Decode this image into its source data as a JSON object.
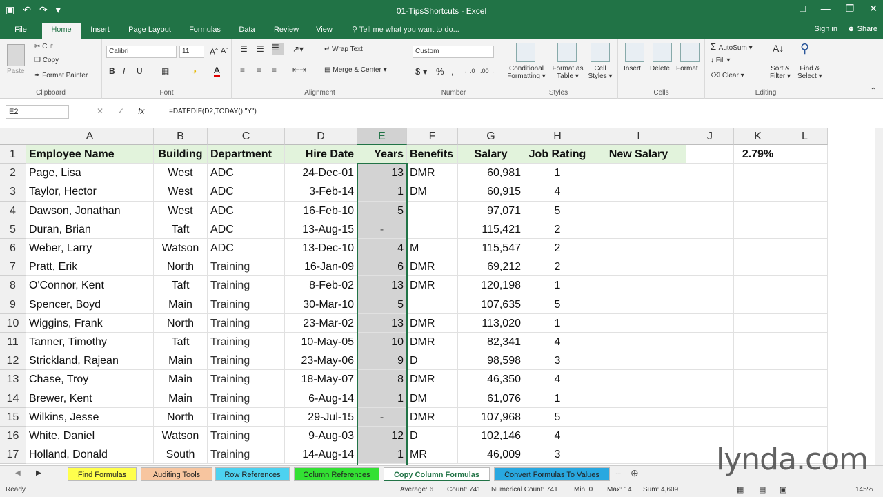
{
  "app": {
    "title": "01-TipsShortcuts - Excel",
    "undo_icon": "undo-icon",
    "redo_icon": "redo-icon",
    "save_icon": "save-icon"
  },
  "tabs": [
    "File",
    "Home",
    "Insert",
    "Page Layout",
    "Formulas",
    "Data",
    "Review",
    "View"
  ],
  "tellme": "Tell me what you want to do...",
  "signin": "Sign in",
  "share": "Share",
  "ribbon": {
    "clipboard": {
      "label": "Clipboard",
      "paste": "Paste",
      "cut": "Cut",
      "copy": "Copy",
      "painter": "Format Painter"
    },
    "font": {
      "label": "Font",
      "name": "Calibri",
      "size": "11"
    },
    "alignment": {
      "label": "Alignment",
      "wrap": "Wrap Text",
      "merge": "Merge & Center"
    },
    "number": {
      "label": "Number",
      "format": "Custom"
    },
    "styles": {
      "label": "Styles",
      "cond": "Conditional",
      "cond2": "Formatting",
      "fmt_table": "Format as",
      "fmt_table2": "Table",
      "cell_styles": "Cell",
      "cell_styles2": "Styles"
    },
    "cells": {
      "label": "Cells",
      "insert": "Insert",
      "delete": "Delete",
      "format": "Format"
    },
    "editing": {
      "label": "Editing",
      "autosum": "AutoSum",
      "fill": "Fill",
      "clear": "Clear",
      "sort": "Sort &",
      "sort2": "Filter",
      "find": "Find &",
      "find2": "Select"
    }
  },
  "formula_bar": {
    "name_box": "E2",
    "formula": "=DATEDIF(D2,TODAY(),\"Y\")",
    "fx": "fx"
  },
  "columns": [
    "A",
    "B",
    "C",
    "D",
    "E",
    "F",
    "G",
    "H",
    "I",
    "J",
    "K",
    "L"
  ],
  "header_row": [
    "Employee Name",
    "Building",
    "Department",
    "Hire Date",
    "Years",
    "Benefits",
    "Salary",
    "Job Rating",
    "New Salary",
    "",
    "2.79%",
    ""
  ],
  "rows": [
    [
      "Page, Lisa",
      "West",
      "ADC",
      "24-Dec-01",
      "13",
      "DMR",
      "60,981",
      "1"
    ],
    [
      "Taylor, Hector",
      "West",
      "ADC",
      "3-Feb-14",
      "1",
      "DM",
      "60,915",
      "4"
    ],
    [
      "Dawson, Jonathan",
      "West",
      "ADC",
      "16-Feb-10",
      "5",
      "",
      "97,071",
      "5"
    ],
    [
      "Duran, Brian",
      "Taft",
      "ADC",
      "13-Aug-15",
      "-",
      "",
      "115,421",
      "2"
    ],
    [
      "Weber, Larry",
      "Watson",
      "ADC",
      "13-Dec-10",
      "4",
      "M",
      "115,547",
      "2"
    ],
    [
      "Pratt, Erik",
      "North",
      "Training",
      "16-Jan-09",
      "6",
      "DMR",
      "69,212",
      "2"
    ],
    [
      "O'Connor, Kent",
      "Taft",
      "Training",
      "8-Feb-02",
      "13",
      "DMR",
      "120,198",
      "1"
    ],
    [
      "Spencer, Boyd",
      "Main",
      "Training",
      "30-Mar-10",
      "5",
      "",
      "107,635",
      "5"
    ],
    [
      "Wiggins, Frank",
      "North",
      "Training",
      "23-Mar-02",
      "13",
      "DMR",
      "113,020",
      "1"
    ],
    [
      "Tanner, Timothy",
      "Taft",
      "Training",
      "10-May-05",
      "10",
      "DMR",
      "82,341",
      "4"
    ],
    [
      "Strickland, Rajean",
      "Main",
      "Training",
      "23-May-06",
      "9",
      "D",
      "98,598",
      "3"
    ],
    [
      "Chase, Troy",
      "Main",
      "Training",
      "18-May-07",
      "8",
      "DMR",
      "46,350",
      "4"
    ],
    [
      "Brewer, Kent",
      "Main",
      "Training",
      "6-Aug-14",
      "1",
      "DM",
      "61,076",
      "1"
    ],
    [
      "Wilkins, Jesse",
      "North",
      "Training",
      "29-Jul-15",
      "-",
      "DMR",
      "107,968",
      "5"
    ],
    [
      "White, Daniel",
      "Watson",
      "Training",
      "9-Aug-03",
      "12",
      "D",
      "102,146",
      "4"
    ],
    [
      "Holland, Donald",
      "South",
      "Training",
      "14-Aug-14",
      "1",
      "MR",
      "46,009",
      "3"
    ]
  ],
  "sheet_tabs": [
    {
      "label": "Find Formulas",
      "color": "#ffff4d"
    },
    {
      "label": "Auditing Tools",
      "color": "#f7c59f"
    },
    {
      "label": "Row References",
      "color": "#4dd2f0"
    },
    {
      "label": "Column References",
      "color": "#33e033"
    },
    {
      "label": "Copy Column Formulas",
      "color": "#ffffff"
    },
    {
      "label": "Convert Formulas To Values",
      "color": "#29a8e0"
    }
  ],
  "status": {
    "ready": "Ready",
    "average": "Average: 6",
    "count": "Count: 741",
    "numcount": "Numerical Count: 741",
    "min": "Min: 0",
    "max": "Max: 14",
    "sum": "Sum: 4,609",
    "zoom": "145%"
  },
  "watermark": "lynda.com"
}
